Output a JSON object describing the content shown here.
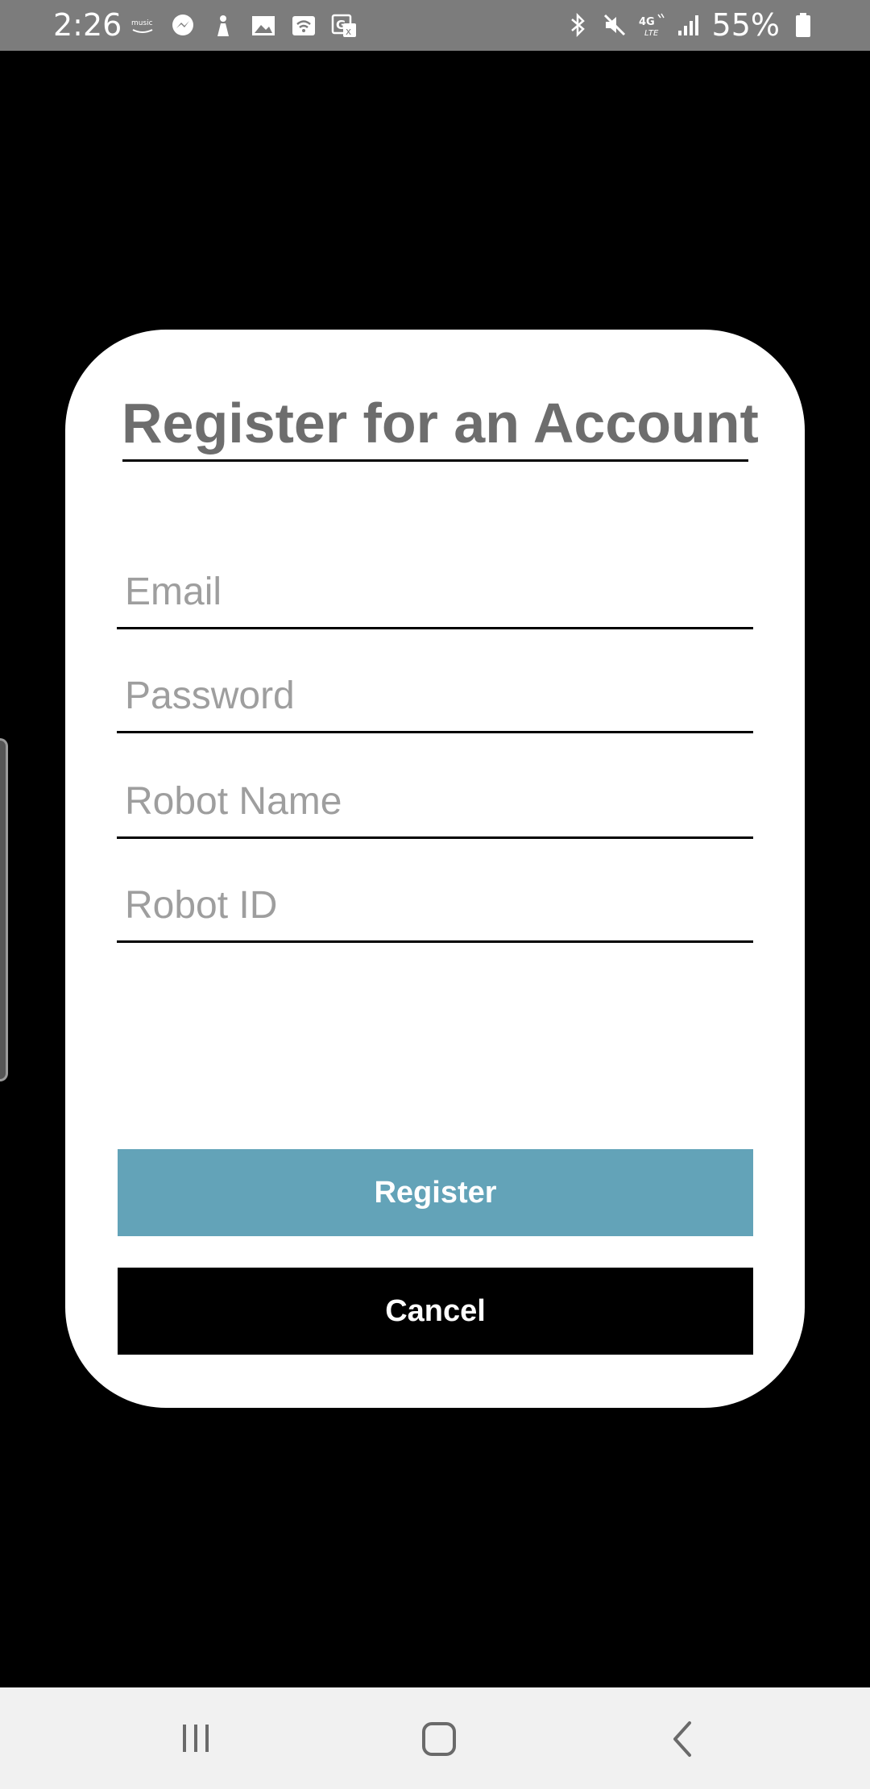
{
  "status_bar": {
    "time": "2:26",
    "battery": "55%",
    "left_icons": [
      "amazon-music-icon",
      "messenger-icon",
      "notification-app-icon",
      "gallery-icon",
      "wifi-calling-icon",
      "translate-icon"
    ],
    "right_icons": [
      "bluetooth-icon",
      "mute-icon",
      "4g-lte-icon",
      "signal-icon",
      "battery-icon"
    ]
  },
  "dialog": {
    "title": "Register for an Account",
    "fields": {
      "email": {
        "placeholder": "Email",
        "value": ""
      },
      "password": {
        "placeholder": "Password",
        "value": ""
      },
      "robot_name": {
        "placeholder": "Robot Name",
        "value": ""
      },
      "robot_id": {
        "placeholder": "Robot ID",
        "value": ""
      }
    },
    "register_label": "Register",
    "cancel_label": "Cancel"
  },
  "nav_bar": {
    "icons": [
      "recent-apps-icon",
      "home-icon",
      "back-icon"
    ]
  },
  "colors": {
    "status_bar_bg": "#7c7c7c",
    "background": "#000000",
    "dialog_bg": "#ffffff",
    "title": "#6d6d6d",
    "placeholder": "#9e9e9e",
    "register_button": "#63a3b8",
    "cancel_button": "#000000",
    "nav_bar_bg": "#f1f1f1"
  }
}
